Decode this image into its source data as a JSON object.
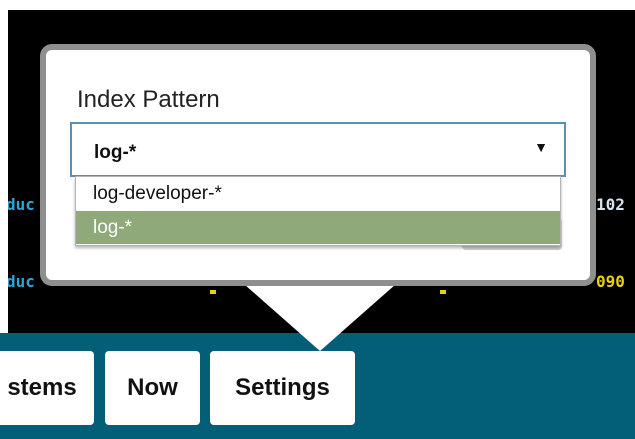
{
  "terminal": {
    "line1_left": "duc",
    "line1_right": "102",
    "line2_left": "duc",
    "line2_right": "090"
  },
  "popup": {
    "label": "Index Pattern",
    "select_value": "log-*",
    "arrow": "▼",
    "options": [
      "log-developer-*",
      "log-*"
    ],
    "selected_option_color": "#8fa97a"
  },
  "bottom_bar": {
    "color": "#035f77",
    "buttons": [
      "stems",
      "Now",
      "Settings"
    ]
  }
}
